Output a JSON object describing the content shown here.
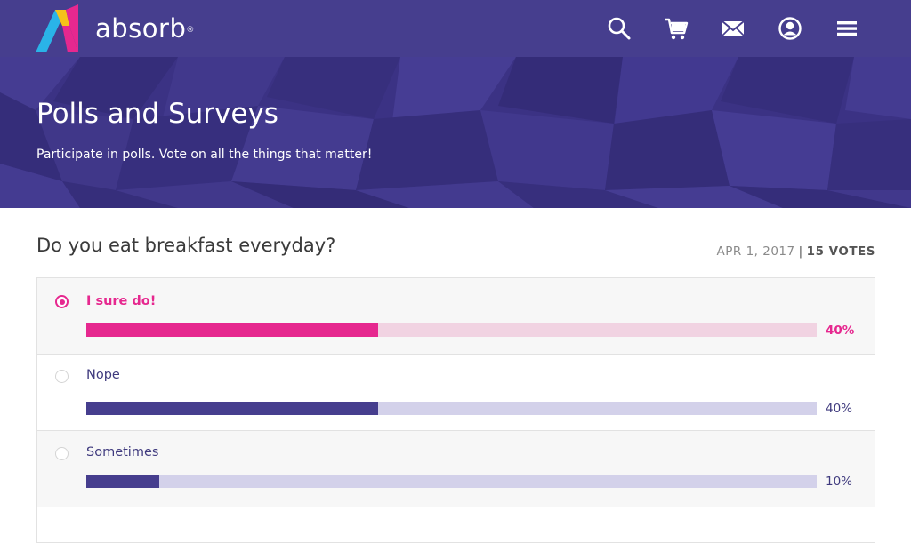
{
  "brand": {
    "name": "absorb",
    "mark": "®"
  },
  "nav": {
    "icons": [
      "search-icon",
      "cart-icon",
      "mail-icon",
      "profile-icon",
      "menu-icon"
    ]
  },
  "hero": {
    "title": "Polls and Surveys",
    "subtitle": "Participate in polls. Vote on all the things that matter!"
  },
  "poll": {
    "question": "Do you eat breakfast everyday?",
    "date": "APR 1, 2017",
    "separator": "|",
    "votes": "15 VOTES",
    "options": [
      {
        "label": "I sure do!",
        "percent_label": "40%",
        "percent": 40,
        "selected": true
      },
      {
        "label": "Nope",
        "percent_label": "40%",
        "percent": 40,
        "selected": false
      },
      {
        "label": "Sometimes",
        "percent_label": "10%",
        "percent": 10,
        "selected": false
      }
    ]
  },
  "colors": {
    "header_bg": "#463e8e",
    "accent_pink": "#e6288f",
    "bar_purple": "#463e8e",
    "track_purple": "#d3d1ea",
    "track_pink": "#f1d3e2"
  }
}
